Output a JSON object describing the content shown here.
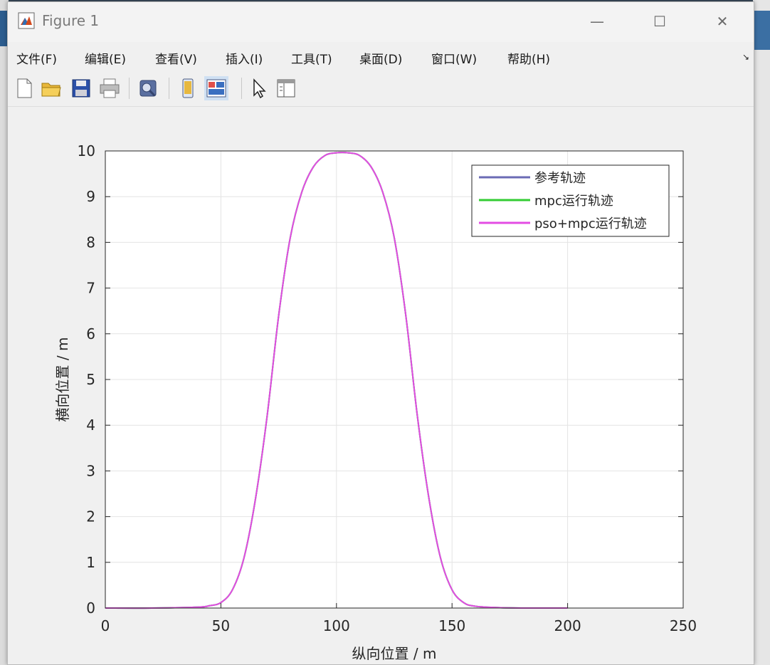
{
  "window": {
    "title": "Figure 1",
    "minimize_glyph": "—",
    "maximize_glyph": "☐",
    "close_glyph": "✕"
  },
  "menu": {
    "items": [
      "文件(F)",
      "编辑(E)",
      "查看(V)",
      "插入(I)",
      "工具(T)",
      "桌面(D)",
      "窗口(W)",
      "帮助(H)"
    ],
    "overflow_glyph": "↘"
  },
  "toolbar": {
    "buttons": [
      "new-figure-icon",
      "open-folder-icon",
      "save-icon",
      "print-icon",
      "link-plot-icon",
      "hide-plot-tools-icon",
      "show-plot-tools-icon",
      "edit-plot-arrow-icon",
      "open-property-inspector-icon"
    ]
  },
  "colors": {
    "reference": "#6b6bb5",
    "mpc": "#33cc33",
    "pso_mpc": "#e34ce3",
    "grid": "#e4e4e4",
    "axis": "#262626"
  },
  "chart_data": {
    "type": "line",
    "xlabel": "纵向位置 / m",
    "ylabel": "横向位置 / m",
    "xlim": [
      0,
      250
    ],
    "ylim": [
      0,
      10
    ],
    "xticks": [
      "0",
      "50",
      "100",
      "150",
      "200",
      "250"
    ],
    "yticks": [
      "0",
      "1",
      "2",
      "3",
      "4",
      "5",
      "6",
      "7",
      "8",
      "9",
      "10"
    ],
    "grid": true,
    "legend_position": "top-right",
    "series": [
      {
        "name": "参考轨迹",
        "x": [
          0,
          20,
          40,
          45,
          50,
          55,
          60,
          65,
          70,
          75,
          80,
          85,
          90,
          95,
          100,
          105,
          110,
          115,
          120,
          125,
          130,
          135,
          140,
          145,
          150,
          155,
          160,
          170,
          180,
          200
        ],
        "y": [
          0,
          0,
          0.02,
          0.05,
          0.12,
          0.4,
          1.1,
          2.4,
          4.2,
          6.4,
          8.1,
          9.1,
          9.65,
          9.9,
          9.96,
          9.96,
          9.9,
          9.65,
          9.1,
          8.1,
          6.4,
          4.2,
          2.4,
          1.1,
          0.4,
          0.12,
          0.04,
          0.01,
          0,
          0
        ]
      },
      {
        "name": "mpc运行轨迹",
        "x": [
          0,
          20,
          40,
          45,
          50,
          55,
          60,
          65,
          70,
          75,
          80,
          85,
          90,
          95,
          100,
          105,
          110,
          115,
          120,
          125,
          130,
          135,
          140,
          145,
          150,
          155,
          160,
          170,
          180,
          200
        ],
        "y": [
          0,
          0,
          0.02,
          0.05,
          0.12,
          0.4,
          1.1,
          2.4,
          4.2,
          6.4,
          8.1,
          9.1,
          9.65,
          9.9,
          9.96,
          9.96,
          9.9,
          9.65,
          9.1,
          8.1,
          6.4,
          4.2,
          2.4,
          1.1,
          0.4,
          0.12,
          0.04,
          0.01,
          0,
          0
        ]
      },
      {
        "name": "pso+mpc运行轨迹",
        "x": [
          0,
          20,
          40,
          45,
          50,
          55,
          60,
          65,
          70,
          75,
          80,
          85,
          90,
          95,
          100,
          105,
          110,
          115,
          120,
          125,
          130,
          135,
          140,
          145,
          150,
          155,
          160,
          170,
          180,
          200
        ],
        "y": [
          0,
          0,
          0.02,
          0.05,
          0.12,
          0.4,
          1.1,
          2.4,
          4.2,
          6.4,
          8.1,
          9.1,
          9.65,
          9.9,
          9.96,
          9.96,
          9.9,
          9.65,
          9.1,
          8.1,
          6.4,
          4.2,
          2.4,
          1.1,
          0.4,
          0.12,
          0.04,
          0.01,
          0,
          0
        ]
      }
    ]
  }
}
